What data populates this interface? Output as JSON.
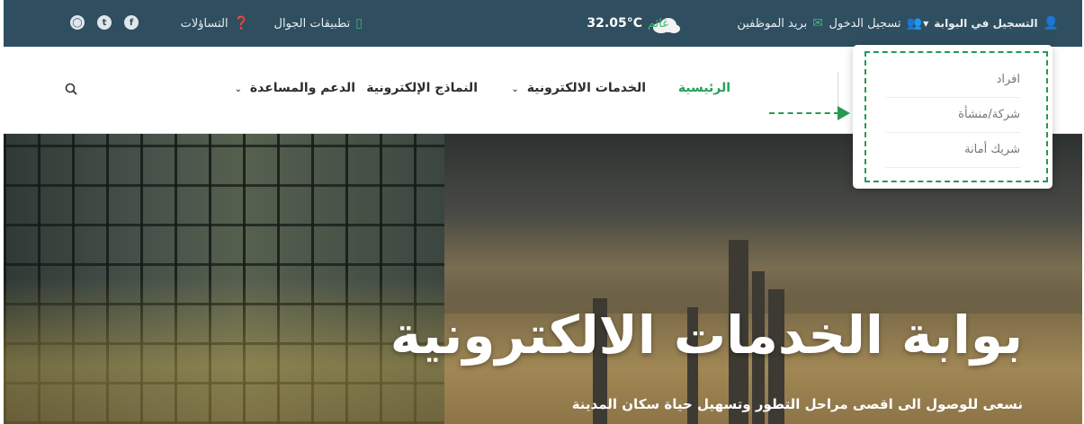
{
  "topbar": {
    "portal_register": "التسجيل في البوابة",
    "login": "تسجيل الدخول",
    "employee_mail": "بريد الموظفين",
    "weather_condition": "غائم",
    "temperature": "32.05°C",
    "mobile_apps": "تطبيقات الجوال",
    "faq": "التساؤلات",
    "social_icons": [
      "facebook-icon",
      "twitter-icon",
      "instagram-icon"
    ]
  },
  "nav": {
    "home": "الرئيسية",
    "e_services": "الخدمات الالكترونية",
    "e_forms": "النماذج الإلكترونية",
    "support": "الدعم والمساعدة"
  },
  "dropdown": {
    "items": [
      "افراد",
      "شركة/منشأة",
      "شريك أمانة"
    ]
  },
  "hero": {
    "title": "بوابة الخدمات الالكترونية",
    "subtitle": "نسعى للوصول الى اقصى مراحل التطور وتسهيل حياة سكان المدينة"
  },
  "colors": {
    "topbar": "#2f4e5f",
    "accent_green": "#24a05a",
    "annotation_green": "#249a55"
  }
}
